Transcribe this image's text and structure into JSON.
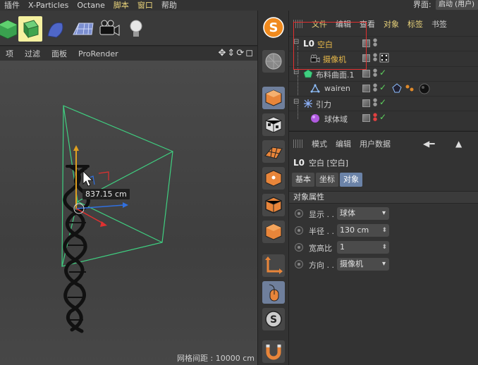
{
  "menubar": {
    "items": [
      {
        "label": "插件",
        "hl": false
      },
      {
        "label": "X-Particles",
        "hl": false
      },
      {
        "label": "Octane",
        "hl": false
      },
      {
        "label": "脚本",
        "hl": true
      },
      {
        "label": "窗口",
        "hl": true
      },
      {
        "label": "帮助",
        "hl": false
      }
    ],
    "interface_label": "界面:",
    "interface_value": "启动 (用户)"
  },
  "toolbar": {
    "tools": [
      "cube-primitive-icon",
      "deformer-icon",
      "spline-icon",
      "plane-floor-icon",
      "camera-icon",
      "light-icon"
    ],
    "selected_index": 1
  },
  "viewport": {
    "menu": [
      "项",
      "过滤",
      "面板",
      "ProRender"
    ],
    "nav_icons": "✥⇕⟳◻",
    "distance_readout": "837.15 cm",
    "grid_spacing": "网格间距 : 10000 cm"
  },
  "object_manager": {
    "menu": [
      {
        "label": "文件",
        "hl": true
      },
      {
        "label": "编辑",
        "hl": false
      },
      {
        "label": "查看",
        "hl": false
      },
      {
        "label": "对象",
        "hl": true
      },
      {
        "label": "标签",
        "hl": true
      },
      {
        "label": "书签",
        "hl": false
      }
    ],
    "rows": [
      {
        "name": "空白",
        "icon": "null-icon",
        "selected": true
      },
      {
        "name": "摄像机",
        "icon": "camera-icon",
        "selected": true
      },
      {
        "name": "布料曲面.1",
        "icon": "cloth-surface-icon",
        "selected": false
      },
      {
        "name": "wairen",
        "icon": "mesh-icon",
        "selected": false
      },
      {
        "name": "引力",
        "icon": "attractor-icon",
        "selected": false
      },
      {
        "name": "球体域",
        "icon": "sphere-field-icon",
        "selected": false
      }
    ]
  },
  "attribute_manager": {
    "menu": [
      "模式",
      "编辑",
      "用户数据"
    ],
    "object_title": "空白 [空白]",
    "tabs": [
      {
        "label": "基本",
        "active": false
      },
      {
        "label": "坐标",
        "active": false
      },
      {
        "label": "对象",
        "active": true
      }
    ],
    "section": "对象属性",
    "props": [
      {
        "label": "显示 . .",
        "value": "球体",
        "kind": "drop"
      },
      {
        "label": "半径 . .",
        "value": "130 cm",
        "kind": "spin"
      },
      {
        "label": "宽高比",
        "value": "1",
        "kind": "spin"
      },
      {
        "label": "方向 . .",
        "value": "摄像机",
        "kind": "drop"
      }
    ]
  },
  "colors": {
    "accent": "#e8d27a",
    "selection": "#e8b94a",
    "active_tab": "#6b83a8",
    "highlight_box": "#e23030",
    "check": "#5ed35e"
  }
}
